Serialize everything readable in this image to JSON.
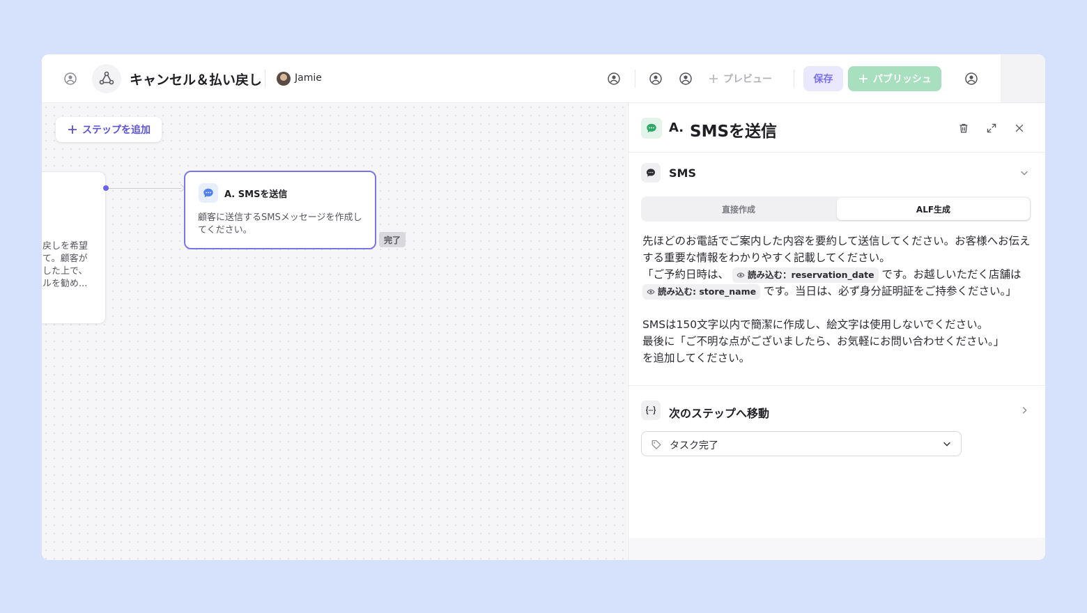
{
  "header": {
    "workflow_title": "キャンセル＆払い戻し",
    "user_name": "Jamie",
    "preview_label": "プレビュー",
    "save_label": "保存",
    "publish_label": "パブリッシュ",
    "icons": [
      "user-circle-icon",
      "workflow-logo-icon",
      "user-circle-icon",
      "user-circle-icon",
      "user-circle-icon",
      "user-circle-icon"
    ]
  },
  "canvas": {
    "add_step_label": "ステップを追加",
    "previous_node_text": "戻しを希望\nて。顧客が\nした上で、\nルを勧め...",
    "node": {
      "title": "A. SMSを送信",
      "description": "顧客に送信するSMSメッセージを作成してください。",
      "status_badge": "完了"
    }
  },
  "panel": {
    "letter": "A.",
    "title": "SMSを送信",
    "actions": [
      "trash-icon",
      "expand-icon",
      "close-icon"
    ],
    "sms_section": {
      "title": "SMS",
      "tabs": [
        "直接作成",
        "ALF生成"
      ],
      "active_tab": "ALF生成",
      "prompt": {
        "line1": "先ほどのお電話でご案内した内容を要約して送信してください。お客様へお伝えする重要な情報をわかりやすく記載してください。",
        "quote_start": "「ご予約日時は、",
        "chip1": "読み込む：reservation_date",
        "mid": "です。お越しいただく店舗は",
        "chip2": "読み込む: store_name",
        "quote_end": "です。当日は、必ず身分証明証をご持参ください。」",
        "line3": "SMSは150文字以内で簡潔に作成し、絵文字は使用しないでください。",
        "line4": "最後に「ご不明な点がございましたら、お気軽にお問い合わせください。」",
        "line5": "を追加してください。"
      }
    },
    "next_step": {
      "title": "次のステップへ移動",
      "select_value": "タスク完了"
    }
  },
  "colors": {
    "accent": "#6c63e8",
    "publish": "#a8dfbf",
    "save_bg": "#e9e8fd",
    "background": "#d6e2fb"
  }
}
